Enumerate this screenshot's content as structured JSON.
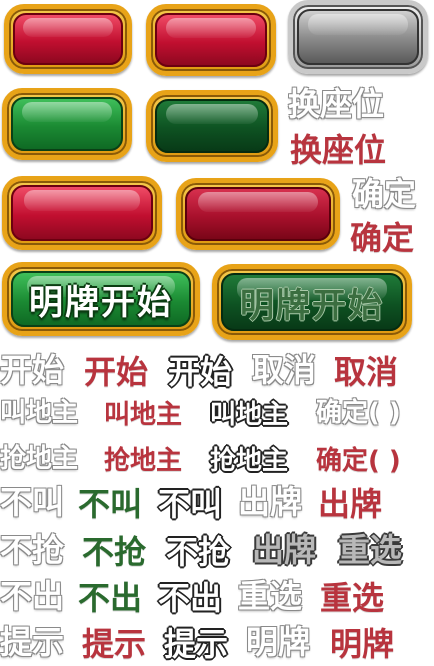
{
  "buttons": {
    "start_show_cards": "明牌开始",
    "start_show_cards_disabled": "明牌开始"
  },
  "labels": {
    "change_seat_outline": "换座位",
    "change_seat_red": "换座位",
    "confirm_outline": "确定",
    "confirm_red": "确定",
    "start_outline": "开始",
    "start_red": "开始",
    "start_dark": "开始",
    "cancel_outline": "取消",
    "cancel_red": "取消",
    "call_landlord_outline": "叫地主",
    "call_landlord_red": "叫地主",
    "call_landlord_dark": "叫地主",
    "confirm_paren_outline": "确定(  )",
    "grab_landlord_outline": "抢地主",
    "grab_landlord_red": "抢地主",
    "grab_landlord_dark": "抢地主",
    "confirm_paren_red": "确定(  )",
    "no_call_outline": "不叫",
    "no_call_green": "不叫",
    "no_call_dark": "不叫",
    "play_cards_outline": "出牌",
    "play_cards_red": "出牌",
    "no_grab_outline": "不抢",
    "no_grab_green": "不抢",
    "no_grab_dark": "不抢",
    "play_cards_dark": "出牌",
    "reselect_dark": "重选",
    "pass_outline": "不出",
    "pass_green": "不出",
    "pass_dark": "不出",
    "reselect_outline": "重选",
    "reselect_red": "重选",
    "hint_outline": "提示",
    "hint_red": "提示",
    "hint_dark": "提示",
    "show_cards_outline": "明牌",
    "show_cards_red": "明牌"
  },
  "colors": {
    "gold_frame": "#e8a318",
    "red_button": "#c10f30",
    "green_button": "#1b8a33",
    "gray_button": "#8e8e8e",
    "red_text": "#b8343e",
    "green_text": "#2a6a2e"
  }
}
